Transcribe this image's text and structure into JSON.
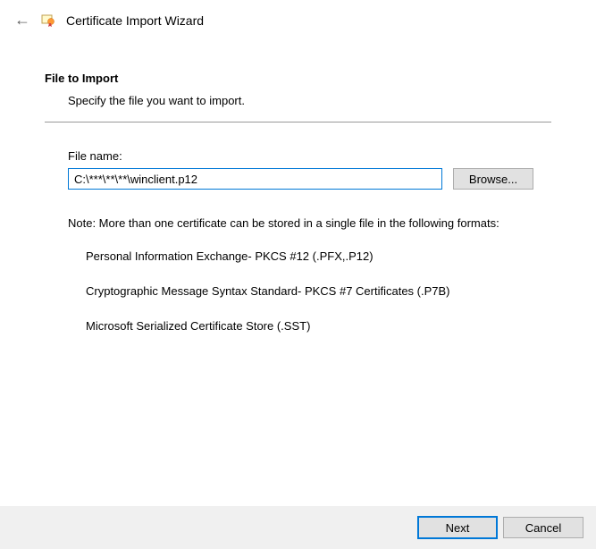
{
  "header": {
    "title": "Certificate Import Wizard"
  },
  "section": {
    "title": "File to Import",
    "description": "Specify the file you want to import."
  },
  "form": {
    "file_label": "File name:",
    "file_value": "C:\\***\\**\\**\\winclient.p12",
    "browse_label": "Browse..."
  },
  "note": {
    "intro": "Note:  More than one certificate can be stored in a single file in the following formats:",
    "items": [
      "Personal Information Exchange- PKCS #12 (.PFX,.P12)",
      "Cryptographic Message Syntax Standard- PKCS #7 Certificates (.P7B)",
      "Microsoft Serialized Certificate Store (.SST)"
    ]
  },
  "footer": {
    "next_label": "Next",
    "cancel_label": "Cancel"
  }
}
